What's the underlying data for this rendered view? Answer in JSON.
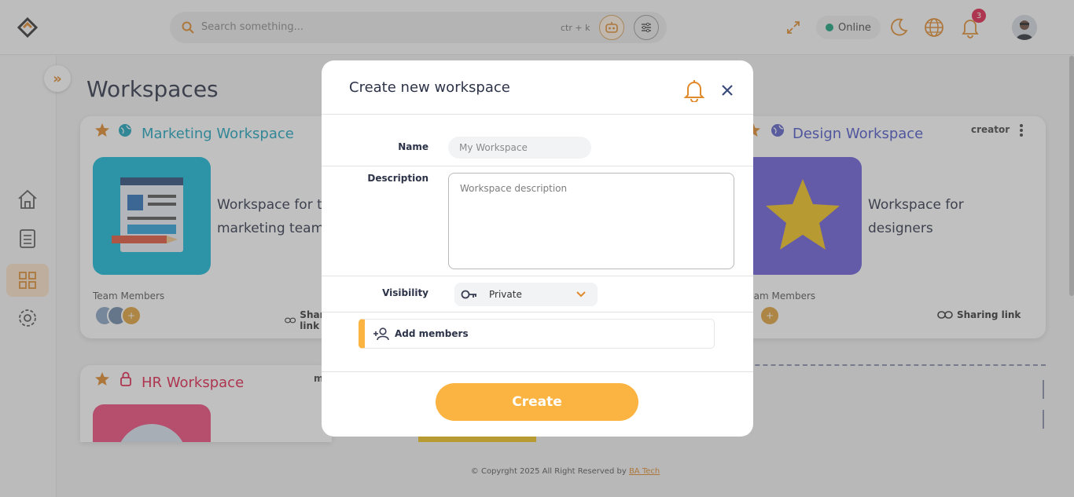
{
  "header": {
    "search_placeholder": "Search something...",
    "search_shortcut": "ctr + k",
    "status_label": "Online",
    "notification_count": "3"
  },
  "page": {
    "title": "Workspaces"
  },
  "cards": [
    {
      "title": "Marketing Workspace",
      "description": "Workspace for the marketing team",
      "team_members_label": "Team Members",
      "sharing_label": "Sharing link",
      "title_color": "#1ba3bd",
      "thumb_color": "#12b7d6"
    },
    {
      "title": "Design Workspace",
      "role": "creator",
      "description": "Workspace for designers",
      "team_members_label": "Team Members",
      "sharing_label": "Sharing link",
      "title_color": "#4a55c8",
      "thumb_color": "#6a5bd8"
    },
    {
      "title": "HR Workspace",
      "role": "m",
      "title_color": "#e0204a",
      "thumb_color": "#ee4a7a"
    }
  ],
  "footer": {
    "text": "© Copyrght 2025 All Right Reserved by ",
    "link": "BA Tech"
  },
  "modal": {
    "title": "Create new workspace",
    "name_label": "Name",
    "name_placeholder": "My Workspace",
    "description_label": "Description",
    "description_placeholder": "Workspace description",
    "visibility_label": "Visibility",
    "visibility_value": "Private",
    "add_members_label": "Add members",
    "create_label": "Create"
  },
  "colors": {
    "accent": "#fbb442",
    "accent_dark": "#e08a2b",
    "online": "#15a07a",
    "badge": "#e0204a"
  }
}
